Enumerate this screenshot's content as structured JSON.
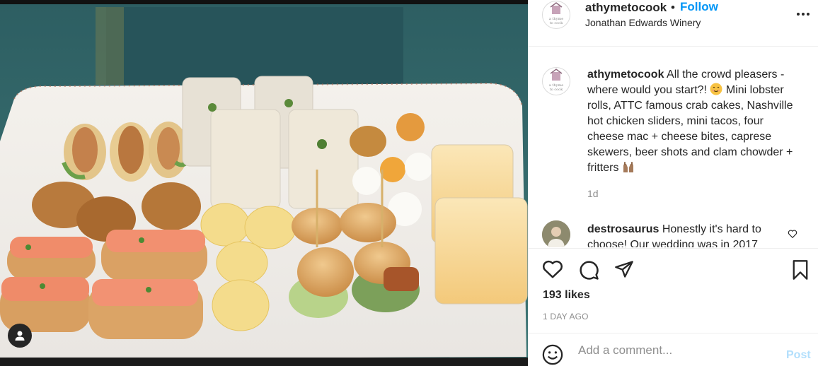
{
  "post": {
    "username": "athymetocook",
    "dot": "•",
    "follow_label": "Follow",
    "location": "Jonathan Edwards Winery",
    "avatar_text": "a thyme to cook"
  },
  "caption": {
    "username": "athymetocook",
    "text_part1": "All the crowd pleasers - where would you start?!",
    "text_part2": "Mini lobster rolls, ATTC famous crab cakes, Nashville hot chicken sliders, mini tacos, four cheese mac + cheese bites, caprese skewers, beer shots and clam chowder + fritters",
    "emoji_1": "smiling-face-icon",
    "emoji_2": "raised-hands-icon",
    "time": "1d"
  },
  "comment": {
    "username": "destrosaurus",
    "text": "Honestly it's hard to choose! Our wedding was in 2017"
  },
  "stats": {
    "likes": "193 likes",
    "date": "1 DAY AGO"
  },
  "add_comment": {
    "placeholder": "Add a comment...",
    "post_label": "Post"
  },
  "icons": [
    "more-icon",
    "heart-icon",
    "comment-icon",
    "share-icon",
    "bookmark-icon",
    "smiley-icon",
    "user-tag-icon"
  ],
  "colors": {
    "follow": "#0095f6",
    "post_disabled": "#b2dffc",
    "muted": "#8e8e8e",
    "text": "#262626"
  }
}
